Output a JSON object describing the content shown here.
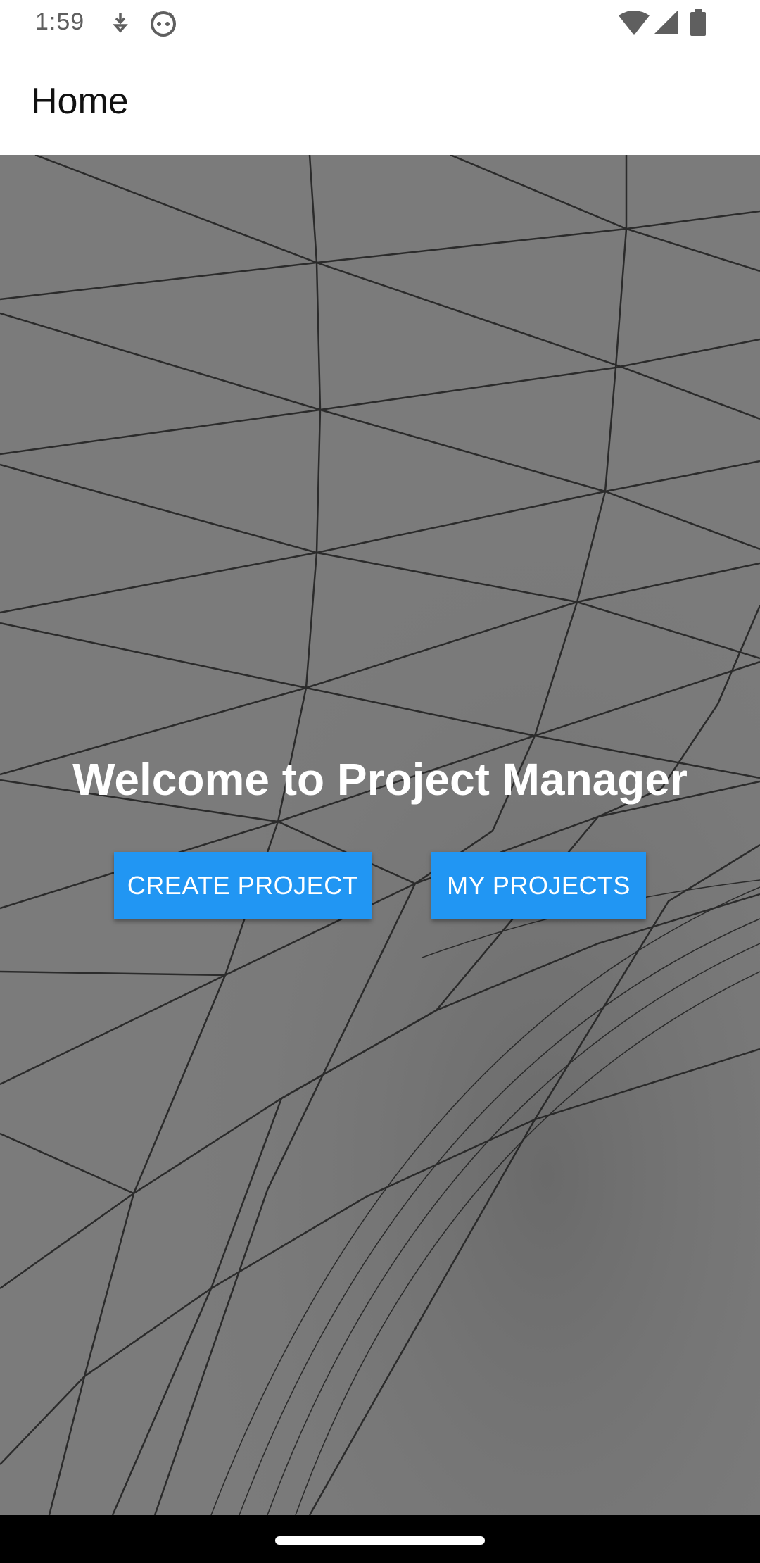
{
  "status_bar": {
    "time": "1:59",
    "icons": [
      "download-icon",
      "android-face-icon",
      "wifi-icon",
      "cellular-signal-icon",
      "battery-icon"
    ]
  },
  "app_bar": {
    "title": "Home"
  },
  "main": {
    "welcome_text": "Welcome to Project Manager",
    "create_button_label": "CREATE PROJECT",
    "my_projects_button_label": "MY PROJECTS"
  },
  "colors": {
    "accent": "#2196f3",
    "background_gray": "#7d7d7d",
    "nav_bar": "#000000"
  }
}
